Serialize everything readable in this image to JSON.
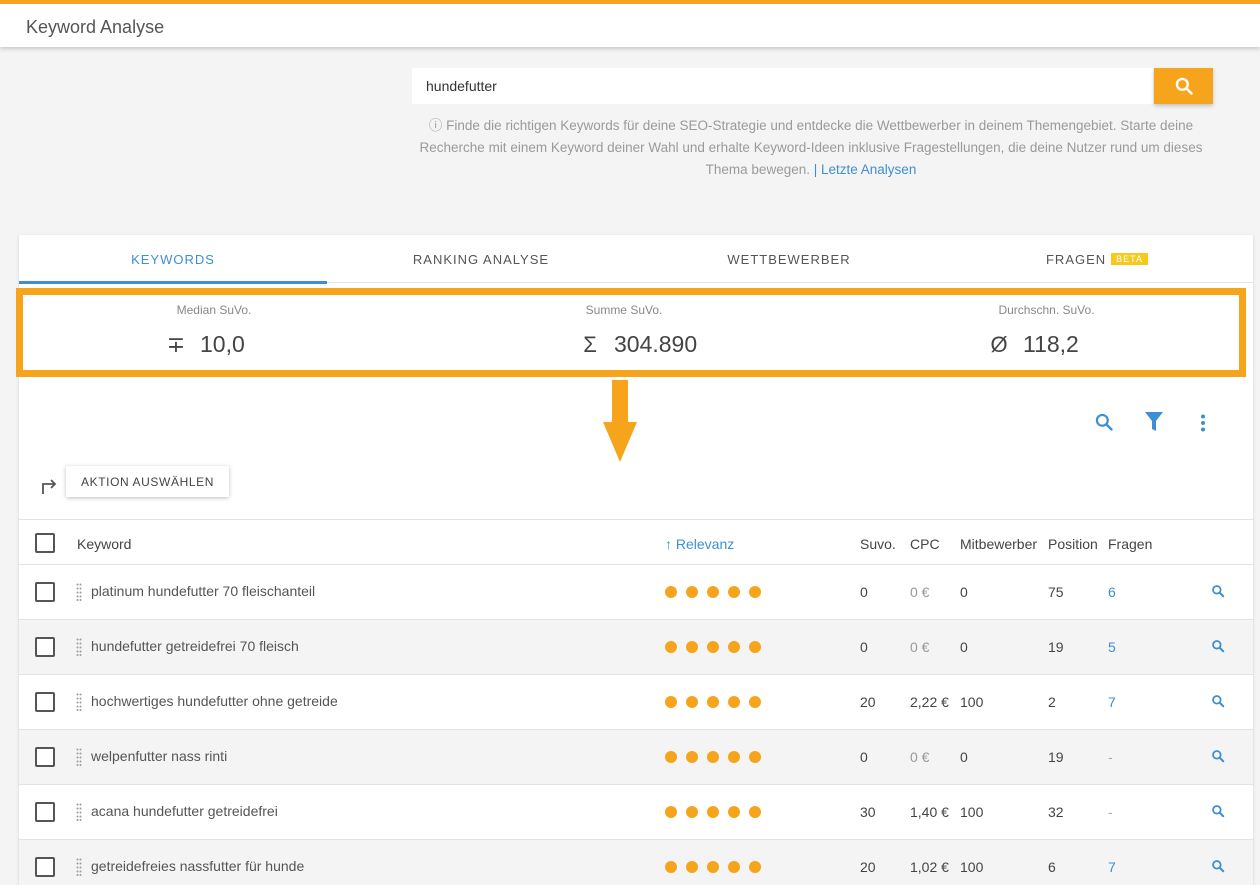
{
  "app": {
    "title": "Keyword Analyse"
  },
  "search": {
    "value": "hundefutter"
  },
  "hint": {
    "text": "ⓘ Finde die richtigen Keywords für deine SEO-Strategie und entdecke die Wettbewerber in deinem Themengebiet. Starte deine Recherche mit einem Keyword deiner Wahl und erhalte Keyword-Ideen inklusive Fragestellungen, die deine Nutzer rund um dieses Thema bewegen.",
    "link": "| Letzte Analysen"
  },
  "tabs": [
    {
      "label": "KEYWORDS",
      "active": true
    },
    {
      "label": "RANKING ANALYSE",
      "active": false
    },
    {
      "label": "WETTBEWERBER",
      "active": false
    },
    {
      "label": "FRAGEN",
      "badge": "BETA",
      "active": false
    }
  ],
  "stats": [
    {
      "label": "Median SuVo.",
      "symbol": "∓",
      "value": "10,0"
    },
    {
      "label": "Summe SuVo.",
      "symbol": "Σ",
      "value": "304.890"
    },
    {
      "label": "Durchschn. SuVo.",
      "symbol": "Ø",
      "value": "118,2"
    }
  ],
  "toolbar": {
    "action_label": "AKTION AUSWÄHLEN"
  },
  "table": {
    "headers": {
      "keyword": "Keyword",
      "relevanz": "↑ Relevanz",
      "suvo": "Suvo.",
      "cpc": "CPC",
      "mitbewerber": "Mitbewerber",
      "position": "Position",
      "fragen": "Fragen"
    },
    "rows": [
      {
        "keyword": "platinum hundefutter 70 fleischanteil",
        "relevanz": 5,
        "suvo": "0",
        "cpc": "0 €",
        "mitbewerber": "0",
        "position": "75",
        "fragen": "6"
      },
      {
        "keyword": "hundefutter getreidefrei 70 fleisch",
        "relevanz": 5,
        "suvo": "0",
        "cpc": "0 €",
        "mitbewerber": "0",
        "position": "19",
        "fragen": "5"
      },
      {
        "keyword": "hochwertiges hundefutter ohne getreide",
        "relevanz": 5,
        "suvo": "20",
        "cpc": "2,22 €",
        "mitbewerber": "100",
        "position": "2",
        "fragen": "7"
      },
      {
        "keyword": "welpenfutter nass rinti",
        "relevanz": 5,
        "suvo": "0",
        "cpc": "0 €",
        "mitbewerber": "0",
        "position": "19",
        "fragen": "-"
      },
      {
        "keyword": "acana hundefutter getreidefrei",
        "relevanz": 5,
        "suvo": "30",
        "cpc": "1,40 €",
        "mitbewerber": "100",
        "position": "32",
        "fragen": "-"
      },
      {
        "keyword": "getreidefreies nassfutter für hunde",
        "relevanz": 5,
        "suvo": "20",
        "cpc": "1,02 €",
        "mitbewerber": "100",
        "position": "6",
        "fragen": "7"
      }
    ]
  },
  "colors": {
    "accent": "#f7a41d",
    "link": "#3d8fd1",
    "beta": "#f7c91d"
  },
  "icons": {
    "search": "search-icon",
    "filter": "filter-icon",
    "more": "more-vert-icon",
    "redirect": "redirect-arrow-icon",
    "drag": "drag-handle-icon"
  }
}
